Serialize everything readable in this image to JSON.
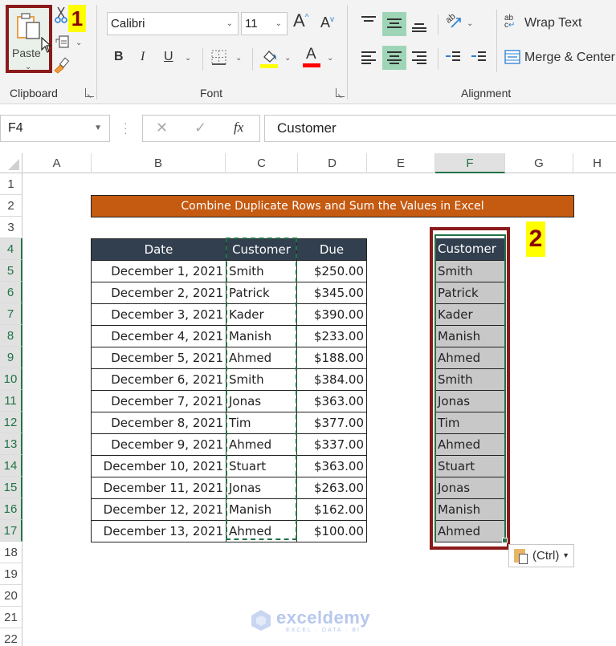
{
  "ribbon": {
    "clipboard": {
      "group_label": "Clipboard",
      "paste_label": "Paste",
      "step_marker": "1",
      "icons": [
        "paste-icon",
        "cut-icon",
        "copy-icon",
        "format-painter-icon",
        "chevron-down-icon"
      ]
    },
    "font": {
      "group_label": "Font",
      "font_name": "Calibri",
      "font_size": "11",
      "increase_font_glyph": "A",
      "decrease_font_glyph": "A",
      "bold_glyph": "B",
      "italic_glyph": "I",
      "underline_glyph": "U",
      "font_color_glyph": "A",
      "fill_color": "#ffff00",
      "font_color": "#ff0000"
    },
    "alignment": {
      "group_label": "Alignment",
      "wrap_text_label": "Wrap Text",
      "merge_center_label": "Merge & Center",
      "active_vertical": "middle",
      "active_horizontal": "center",
      "orientation_glyph": "ab"
    }
  },
  "formula_bar": {
    "name_box": "F4",
    "fx_label": "fx",
    "content": "Customer"
  },
  "grid": {
    "columns": [
      "A",
      "B",
      "C",
      "D",
      "E",
      "F",
      "G",
      "H"
    ],
    "selected_column": "F",
    "rows": [
      "1",
      "2",
      "3",
      "4",
      "5",
      "6",
      "7",
      "8",
      "9",
      "10",
      "11",
      "12",
      "13",
      "14",
      "15",
      "16",
      "17",
      "18",
      "19",
      "20",
      "21",
      "22"
    ],
    "selected_rows_from": 4,
    "selected_rows_to": 17
  },
  "sheet": {
    "title": "Combine Duplicate Rows and Sum the Values in Excel",
    "title_color": "#c55a11",
    "header_color": "#323f4f",
    "table": {
      "headers": [
        "Date",
        "Customer",
        "Due"
      ],
      "rows": [
        [
          "December 1, 2021",
          "Smith",
          "$250.00"
        ],
        [
          "December 2, 2021",
          "Patrick",
          "$345.00"
        ],
        [
          "December 3, 2021",
          "Kader",
          "$390.00"
        ],
        [
          "December 4, 2021",
          "Manish",
          "$233.00"
        ],
        [
          "December 5, 2021",
          "Ahmed",
          "$188.00"
        ],
        [
          "December 6, 2021",
          "Smith",
          "$384.00"
        ],
        [
          "December 7, 2021",
          "Jonas",
          "$363.00"
        ],
        [
          "December 8, 2021",
          "Tim",
          "$377.00"
        ],
        [
          "December 9, 2021",
          "Ahmed",
          "$337.00"
        ],
        [
          "December 10, 2021",
          "Stuart",
          "$363.00"
        ],
        [
          "December 11, 2021",
          "Jonas",
          "$263.00"
        ],
        [
          "December 12, 2021",
          "Manish",
          "$162.00"
        ],
        [
          "December 13, 2021",
          "Ahmed",
          "$100.00"
        ]
      ]
    },
    "pasted_column": {
      "header": "Customer",
      "values": [
        "Smith",
        "Patrick",
        "Kader",
        "Manish",
        "Ahmed",
        "Smith",
        "Jonas",
        "Tim",
        "Ahmed",
        "Stuart",
        "Jonas",
        "Manish",
        "Ahmed"
      ],
      "step_marker": "2"
    },
    "paste_options_label": "(Ctrl)"
  },
  "watermark": {
    "name": "exceldemy",
    "tagline": "EXCEL · DATA · BI"
  }
}
